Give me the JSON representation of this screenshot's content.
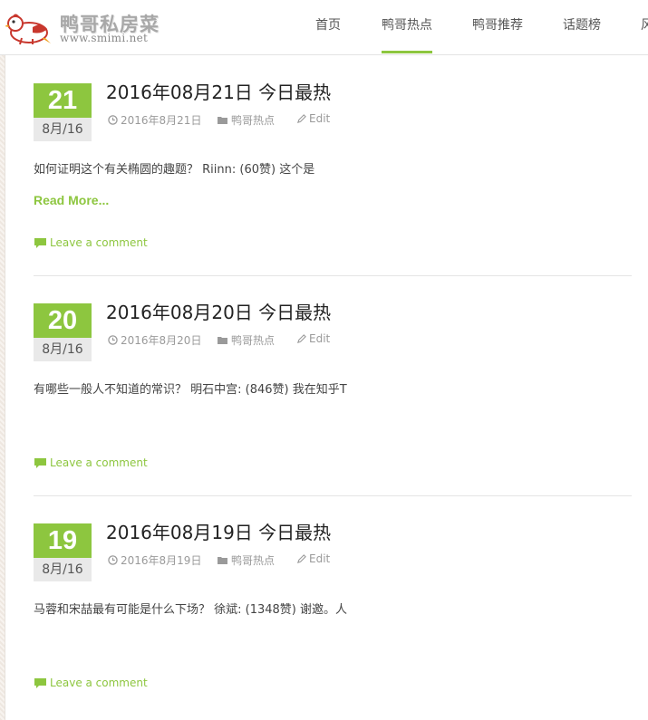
{
  "site": {
    "logo_title": "鸭哥私房菜",
    "logo_url": "www.smimi.net",
    "colors": {
      "accent": "#8dc63f",
      "logo_red": "#c8372d"
    }
  },
  "nav": {
    "items": [
      {
        "label": "首页",
        "active": false
      },
      {
        "label": "鸭哥热点",
        "active": true
      },
      {
        "label": "鸭哥推荐",
        "active": false
      },
      {
        "label": "话题榜",
        "active": false
      },
      {
        "label": "风",
        "active": false
      }
    ]
  },
  "posts": [
    {
      "day": "21",
      "month": "8月/16",
      "title": "2016年08月21日 今日最热",
      "meta_date": "2016年8月21日",
      "meta_category": "鸭哥热点",
      "meta_edit": "Edit",
      "excerpt": "如何证明这个有关椭圆的趣题？ Riinn: (60赞) 这个是",
      "read_more": "Read More...",
      "comment_label": "Leave a comment"
    },
    {
      "day": "20",
      "month": "8月/16",
      "title": "2016年08月20日 今日最热",
      "meta_date": "2016年8月20日",
      "meta_category": "鸭哥热点",
      "meta_edit": "Edit",
      "excerpt": "有哪些一般人不知道的常识？ 明石中宫: (846赞) 我在知乎T",
      "comment_label": "Leave a comment"
    },
    {
      "day": "19",
      "month": "8月/16",
      "title": "2016年08月19日 今日最热",
      "meta_date": "2016年8月19日",
      "meta_category": "鸭哥热点",
      "meta_edit": "Edit",
      "excerpt": "马蓉和宋喆最有可能是什么下场？ 徐斌: (1348赞) 谢邀。人",
      "comment_label": "Leave a comment"
    }
  ],
  "icons": {
    "date": "clock-icon",
    "category": "folder-icon",
    "edit": "pencil-icon",
    "comment": "speech-bubble-icon"
  }
}
